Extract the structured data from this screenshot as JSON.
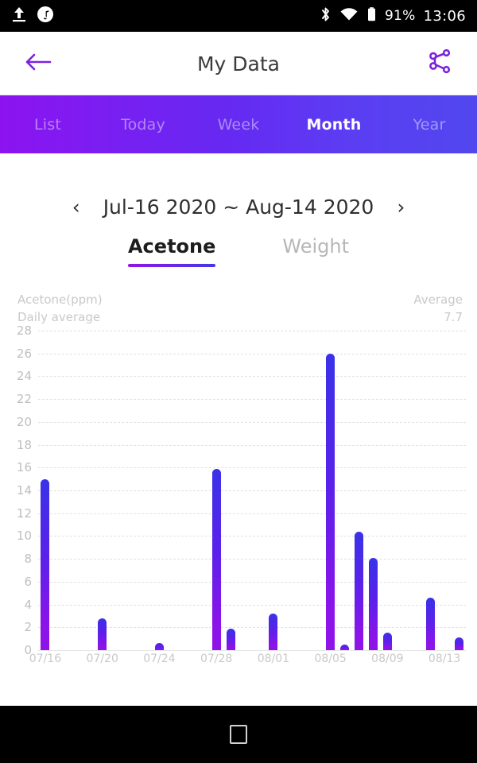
{
  "status_bar": {
    "icons_left": [
      "upload-icon",
      "music-note-icon"
    ],
    "icons_right": [
      "bluetooth-icon",
      "wifi-icon",
      "battery-icon"
    ],
    "battery_percent": "91%",
    "clock": "13:06"
  },
  "app_bar": {
    "back_icon": "back-arrow-icon",
    "title": "My Data",
    "share_icon": "share-nodes-icon"
  },
  "period_tabs": {
    "items": [
      {
        "label": "List",
        "active": false
      },
      {
        "label": "Today",
        "active": false
      },
      {
        "label": "Week",
        "active": false
      },
      {
        "label": "Month",
        "active": true
      },
      {
        "label": "Year",
        "active": false
      }
    ]
  },
  "date_range": {
    "prev_icon": "chevron-left-icon",
    "label": "Jul-16 2020 ~ Aug-14 2020",
    "next_icon": "chevron-right-icon"
  },
  "metric_tabs": {
    "items": [
      {
        "label": "Acetone",
        "active": true
      },
      {
        "label": "Weight",
        "active": false
      }
    ]
  },
  "chart_header": {
    "unit_label": "Acetone(ppm)",
    "series_label": "Daily average",
    "average_label": "Average",
    "average_value": "7.7"
  },
  "colors": {
    "accent_purple": "#9013e8",
    "accent_blue": "#3a32e8",
    "tab_gradient_start": "#8c13f0",
    "tab_gradient_end": "#5147ef",
    "axis_text": "#bfbfbf",
    "gridline": "#e2e2e2"
  },
  "chart_data": {
    "type": "bar",
    "title": "Acetone(ppm) Daily average",
    "xlabel": "",
    "ylabel": "Acetone(ppm)",
    "ylim": [
      0,
      28
    ],
    "ytick_step": 2,
    "yticks": [
      0,
      2,
      4,
      6,
      8,
      10,
      12,
      14,
      16,
      18,
      20,
      22,
      24,
      26,
      28
    ],
    "grid": true,
    "legend": "none",
    "average": 7.7,
    "categories": [
      "07/16",
      "07/17",
      "07/18",
      "07/19",
      "07/20",
      "07/21",
      "07/22",
      "07/23",
      "07/24",
      "07/25",
      "07/26",
      "07/27",
      "07/28",
      "07/29",
      "07/30",
      "07/31",
      "08/01",
      "08/02",
      "08/03",
      "08/04",
      "08/05",
      "08/06",
      "08/07",
      "08/08",
      "08/09",
      "08/10",
      "08/11",
      "08/12",
      "08/13",
      "08/14"
    ],
    "values": [
      15.0,
      0,
      0,
      0,
      2.8,
      0,
      0,
      0,
      0.6,
      0,
      0,
      0,
      15.9,
      1.9,
      0,
      0,
      3.2,
      0,
      0,
      0,
      26.0,
      0.5,
      10.4,
      8.1,
      1.5,
      0,
      0,
      4.6,
      0,
      1.1
    ],
    "xtick_labels": [
      "07/16",
      "07/20",
      "07/24",
      "07/28",
      "08/01",
      "08/05",
      "08/09",
      "08/13"
    ],
    "xtick_indices": [
      0,
      4,
      8,
      12,
      16,
      20,
      24,
      28
    ]
  },
  "nav_bar": {
    "recents_icon": "square-recents-icon"
  }
}
